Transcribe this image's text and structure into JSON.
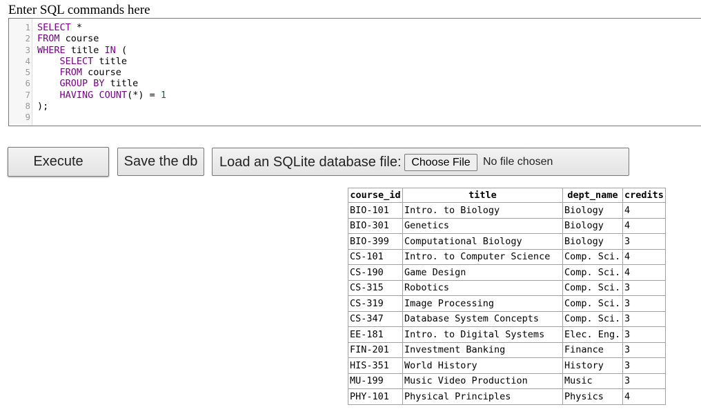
{
  "prompt_label": "Enter SQL commands here",
  "editor": {
    "line_numbers": [
      "1",
      "2",
      "3",
      "4",
      "5",
      "6",
      "7",
      "8",
      "9"
    ],
    "lines": [
      [
        {
          "t": "SELECT",
          "c": "kw"
        },
        {
          "t": " *",
          "c": "plain"
        }
      ],
      [
        {
          "t": "FROM",
          "c": "kw"
        },
        {
          "t": " course",
          "c": "plain"
        }
      ],
      [
        {
          "t": "WHERE",
          "c": "kw"
        },
        {
          "t": " title ",
          "c": "plain"
        },
        {
          "t": "IN",
          "c": "kw"
        },
        {
          "t": " (",
          "c": "plain"
        }
      ],
      [
        {
          "t": "    ",
          "c": "plain"
        },
        {
          "t": "SELECT",
          "c": "kw"
        },
        {
          "t": " title",
          "c": "plain"
        }
      ],
      [
        {
          "t": "    ",
          "c": "plain"
        },
        {
          "t": "FROM",
          "c": "kw"
        },
        {
          "t": " course",
          "c": "plain"
        }
      ],
      [
        {
          "t": "    ",
          "c": "plain"
        },
        {
          "t": "GROUP BY",
          "c": "kw"
        },
        {
          "t": " title",
          "c": "plain"
        }
      ],
      [
        {
          "t": "    ",
          "c": "plain"
        },
        {
          "t": "HAVING",
          "c": "kw"
        },
        {
          "t": " ",
          "c": "plain"
        },
        {
          "t": "COUNT",
          "c": "kw"
        },
        {
          "t": "(*) = ",
          "c": "plain"
        },
        {
          "t": "1",
          "c": "num"
        }
      ],
      [
        {
          "t": ");",
          "c": "plain"
        }
      ],
      []
    ]
  },
  "toolbar": {
    "execute_label": "Execute",
    "save_label": "Save the db",
    "load_label": "Load an SQLite database file:",
    "choose_file_label": "Choose File",
    "file_status": "No file chosen"
  },
  "results": {
    "columns": [
      "course_id",
      "title",
      "dept_name",
      "credits"
    ],
    "rows": [
      [
        "BIO-101",
        "Intro. to Biology",
        "Biology",
        "4"
      ],
      [
        "BIO-301",
        "Genetics",
        "Biology",
        "4"
      ],
      [
        "BIO-399",
        "Computational Biology",
        "Biology",
        "3"
      ],
      [
        "CS-101",
        "Intro. to Computer Science",
        "Comp. Sci.",
        "4"
      ],
      [
        "CS-190",
        "Game Design",
        "Comp. Sci.",
        "4"
      ],
      [
        "CS-315",
        "Robotics",
        "Comp. Sci.",
        "3"
      ],
      [
        "CS-319",
        "Image Processing",
        "Comp. Sci.",
        "3"
      ],
      [
        "CS-347",
        "Database System Concepts",
        "Comp. Sci.",
        "3"
      ],
      [
        "EE-181",
        "Intro. to Digital Systems",
        "Elec. Eng.",
        "3"
      ],
      [
        "FIN-201",
        "Investment Banking",
        "Finance",
        "3"
      ],
      [
        "HIS-351",
        "World History",
        "History",
        "3"
      ],
      [
        "MU-199",
        "Music Video Production",
        "Music",
        "3"
      ],
      [
        "PHY-101",
        "Physical Principles",
        "Physics",
        "4"
      ]
    ]
  },
  "colors": {
    "sql_keyword": "#770088",
    "sql_number": "#116644",
    "line_number": "#999999"
  }
}
